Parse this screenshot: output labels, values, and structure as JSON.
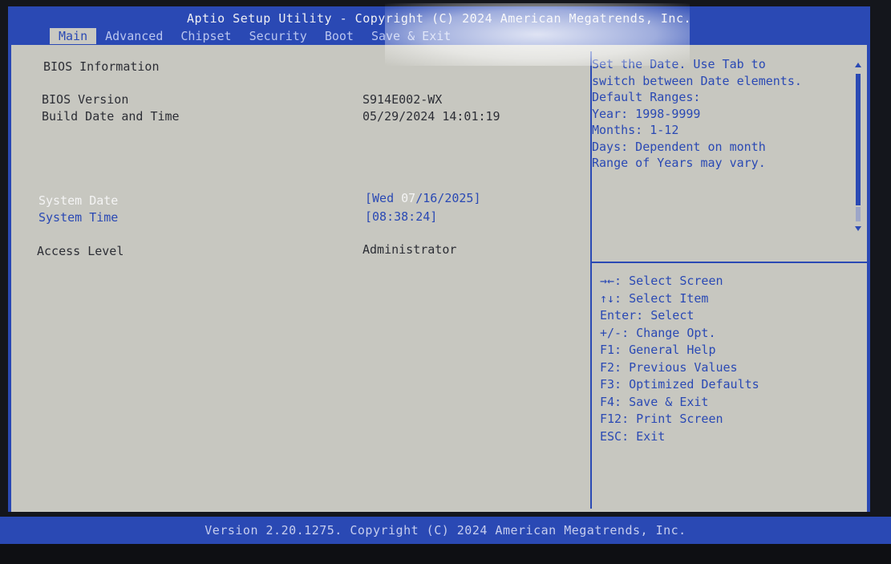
{
  "header": {
    "title": "Aptio Setup Utility - Copyright (C) 2024 American Megatrends, Inc.",
    "tabs": [
      {
        "label": "Main",
        "active": true
      },
      {
        "label": "Advanced",
        "active": false
      },
      {
        "label": "Chipset",
        "active": false
      },
      {
        "label": "Security",
        "active": false
      },
      {
        "label": "Boot",
        "active": false
      },
      {
        "label": "Save & Exit",
        "active": false
      }
    ]
  },
  "main": {
    "section_title": "BIOS Information",
    "bios_version": {
      "label": "BIOS Version",
      "value": "S914E002-WX"
    },
    "build_date": {
      "label": "Build Date and Time",
      "value": "05/29/2024 14:01:19"
    },
    "system_date": {
      "label": "System Date",
      "value_prefix": "[Wed ",
      "value_selected": "07",
      "value_suffix": "/16/2025]"
    },
    "system_time": {
      "label": "System Time",
      "value": "[08:38:24]"
    },
    "access_level": {
      "label": "Access Level",
      "value": "Administrator"
    }
  },
  "help": {
    "lines": [
      "Set the Date. Use Tab to",
      "switch between Date elements.",
      "Default Ranges:",
      "Year: 1998-9999",
      "Months: 1-12",
      "Days: Dependent on month",
      "Range of Years may vary."
    ]
  },
  "keys": {
    "lines": [
      "→←: Select Screen",
      "↑↓: Select Item",
      "Enter: Select",
      "+/-: Change Opt.",
      "F1: General Help",
      "F2: Previous Values",
      "F3: Optimized Defaults",
      "F4: Save & Exit",
      "F12: Print Screen",
      "ESC: Exit"
    ]
  },
  "footer": {
    "text": "Version 2.20.1275. Copyright (C) 2024 American Megatrends, Inc."
  },
  "colors": {
    "bios_blue": "#2a49b4",
    "panel_gray": "#c7c7c0",
    "highlight_white": "#f4f4f4"
  }
}
